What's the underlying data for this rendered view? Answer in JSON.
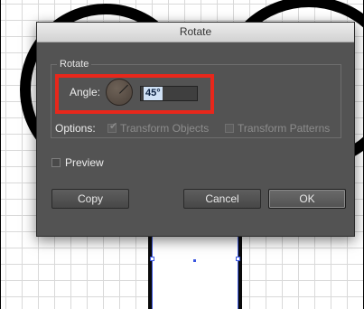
{
  "dialog": {
    "title": "Rotate",
    "group_label": "Rotate",
    "angle_label": "Angle:",
    "angle_value": "45°",
    "dial_angle_degrees": 45,
    "options_label": "Options:",
    "transform_objects_label": "Transform Objects",
    "transform_objects_checked": true,
    "transform_patterns_label": "Transform Patterns",
    "transform_patterns_checked": false,
    "preview_label": "Preview",
    "preview_checked": false,
    "copy_label": "Copy",
    "cancel_label": "Cancel",
    "ok_label": "OK"
  },
  "icons": {
    "angle_dial": "angle-dial-icon",
    "checkmark": "checkmark-icon"
  },
  "colors": {
    "dialog_bg": "#535353",
    "highlight": "#e8271b",
    "selection": "#3a56e0",
    "input_selection": "#cfe1f5"
  }
}
